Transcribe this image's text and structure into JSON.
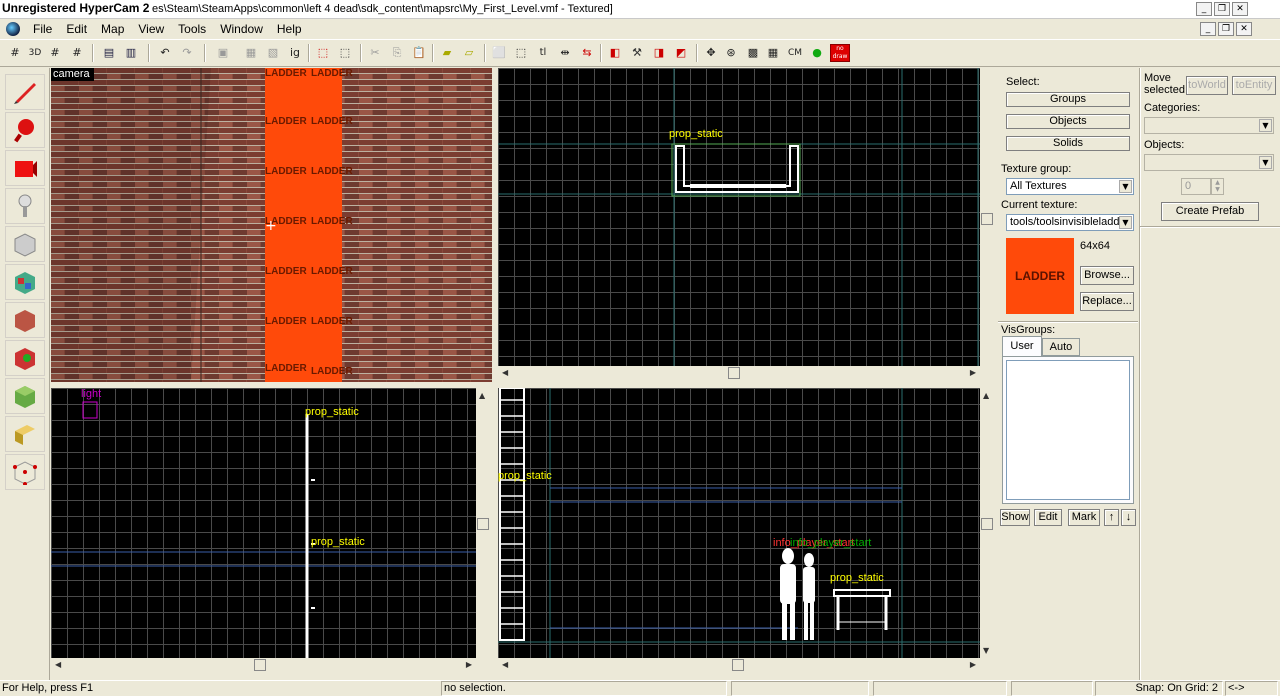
{
  "window": {
    "watermark": "Unregistered HyperCam 2",
    "title": "es\\Steam\\SteamApps\\common\\left 4 dead\\sdk_content\\mapsrc\\My_First_Level.vmf - Textured]"
  },
  "menu": [
    "File",
    "Edit",
    "Map",
    "View",
    "Tools",
    "Window",
    "Help"
  ],
  "toolbar": {
    "labels": [
      "3D",
      "ig",
      "tl",
      "CM",
      "no draw"
    ]
  },
  "viewports": {
    "camera_label": "camera",
    "texture_word": "LADDER",
    "top": {
      "entity": "prop_static"
    },
    "side": {
      "entity1": "prop_static",
      "entity2": "prop_static",
      "light": "light"
    },
    "front": {
      "entity_left": "prop_static",
      "entity_table": "prop_static",
      "info1": "info_player_start",
      "info2": "info_player_start"
    }
  },
  "panel": {
    "select_label": "Select:",
    "groups": "Groups",
    "objects": "Objects",
    "solids": "Solids",
    "move_selected": "Move selected:",
    "to_world": "toWorld",
    "to_entity": "toEntity",
    "categories_label": "Categories:",
    "objects_label": "Objects:",
    "spinner_value": "0",
    "create_prefab": "Create Prefab",
    "texture_group_label": "Texture group:",
    "texture_group_value": "All Textures",
    "current_texture_label": "Current texture:",
    "current_texture_value": "tools/toolsinvisibleladder",
    "texture_size": "64x64",
    "texture_preview_text": "LADDER",
    "browse": "Browse...",
    "replace": "Replace...",
    "visgroups_label": "VisGroups:",
    "tab_user": "User",
    "tab_auto": "Auto",
    "show": "Show",
    "edit": "Edit",
    "mark": "Mark",
    "up": "↑",
    "down": "↓"
  },
  "status": {
    "help": "For Help, press F1",
    "selection": "no selection.",
    "snap": "Snap: On Grid: 2",
    "arrows": "<->"
  },
  "colors": {
    "ladder_orange": "#ff4a0a",
    "grid_line": "#4a4a4a",
    "entity_yellow": "#ffff00",
    "ui_bg": "#ece9d8"
  }
}
